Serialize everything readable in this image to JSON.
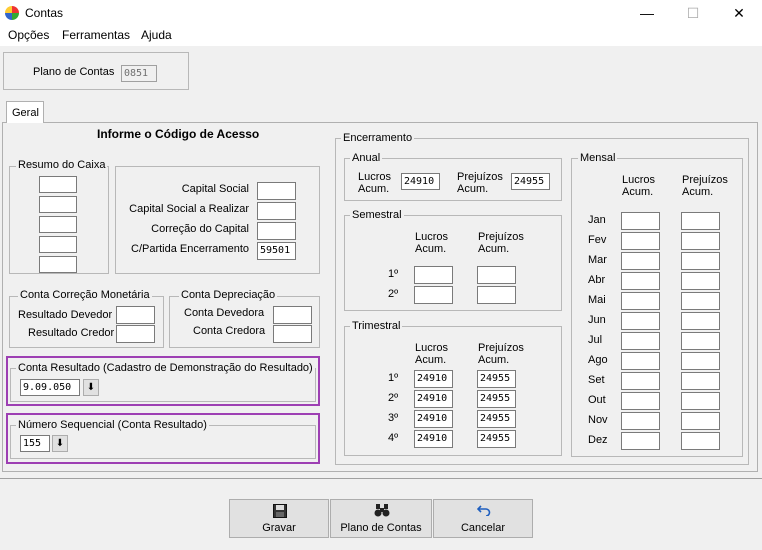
{
  "window": {
    "title": "Contas",
    "minimize": "—",
    "maximize": "☐",
    "close": "✕"
  },
  "menu": [
    "Opções",
    "Ferramentas",
    "Ajuda"
  ],
  "plano": {
    "label": "Plano de Contas",
    "value": "0851"
  },
  "tab": "Geral",
  "heading": "Informe o Código de Acesso",
  "resumo": {
    "legend": "Resumo do Caixa"
  },
  "capital": {
    "labels": [
      "Capital Social",
      "Capital Social a Realizar",
      "Correção do Capital",
      "C/Partida Encerramento"
    ],
    "values": [
      "",
      "",
      "",
      "59501"
    ]
  },
  "correcao": {
    "legend": "Conta Correção Monetária",
    "labels": [
      "Resultado Devedor",
      "Resultado Credor"
    ]
  },
  "depreciacao": {
    "legend": "Conta Depreciação",
    "labels": [
      "Conta Devedora",
      "Conta Credora"
    ]
  },
  "resultado": {
    "legend": "Conta Resultado (Cadastro de Demonstração do Resultado)",
    "value": "9.09.050"
  },
  "sequencial": {
    "legend": "Número Sequencial (Conta Resultado)",
    "value": "155"
  },
  "encerramento": {
    "legend": "Encerramento",
    "anual": {
      "legend": "Anual",
      "lucros_l1": "Lucros",
      "lucros_l2": "Acum.",
      "prej_l1": "Prejuízos",
      "prej_l2": "Acum.",
      "lucros": "24910",
      "prej": "24955"
    },
    "semestral": {
      "legend": "Semestral",
      "lucros_l1": "Lucros",
      "lucros_l2": "Acum.",
      "prej_l1": "Prejuízos",
      "prej_l2": "Acum.",
      "rows": [
        "1º",
        "2º"
      ]
    },
    "trimestral": {
      "legend": "Trimestral",
      "lucros_l1": "Lucros",
      "lucros_l2": "Acum.",
      "prej_l1": "Prejuízos",
      "prej_l2": "Acum.",
      "rows": [
        "1º",
        "2º",
        "3º",
        "4º"
      ],
      "lucros": [
        "24910",
        "24910",
        "24910",
        "24910"
      ],
      "prej": [
        "24955",
        "24955",
        "24955",
        "24955"
      ]
    },
    "mensal": {
      "legend": "Mensal",
      "lucros_l1": "Lucros",
      "lucros_l2": "Acum.",
      "prej_l1": "Prejuízos",
      "prej_l2": "Acum.",
      "months": [
        "Jan",
        "Fev",
        "Mar",
        "Abr",
        "Mai",
        "Jun",
        "Jul",
        "Ago",
        "Set",
        "Out",
        "Nov",
        "Dez"
      ]
    }
  },
  "buttons": {
    "gravar": "Gravar",
    "plano": "Plano de Contas",
    "cancelar": "Cancelar"
  },
  "icons": {
    "save": "floppy-disk-icon",
    "plano": "binoculars-icon",
    "cancel": "undo-arrow-icon",
    "drop": "arrow-down-icon"
  },
  "colors": {
    "highlight": "#9d3fb3"
  }
}
